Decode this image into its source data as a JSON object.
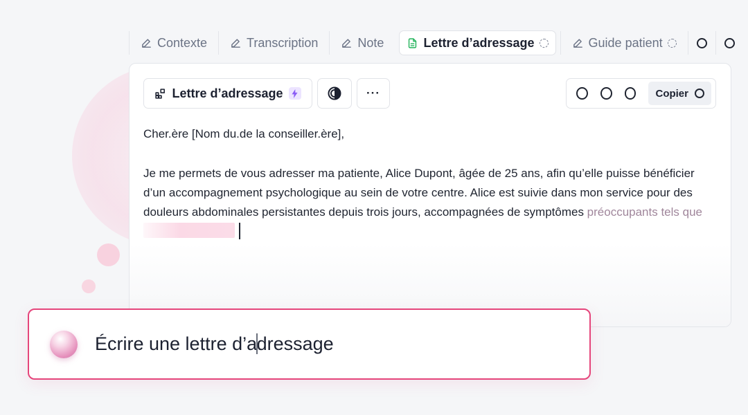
{
  "tabs": [
    {
      "label": "Contexte",
      "icon": "pencil-icon"
    },
    {
      "label": "Transcription",
      "icon": "pencil-icon"
    },
    {
      "label": "Note",
      "icon": "pencil-icon"
    },
    {
      "label": "Lettre d’adressage",
      "icon": "document-icon",
      "active": true,
      "status": "loading"
    },
    {
      "label": "Guide patient",
      "icon": "pencil-icon",
      "status": "loading"
    }
  ],
  "toolbar": {
    "template_label": "Lettre d’adressage",
    "more_label": "···",
    "copy_label": "Copier"
  },
  "letter": {
    "salutation": "Cher.ère [Nom du.de la conseiller.ère],",
    "body": "Je me permets de vous adresser ma patiente, Alice Dupont, âgée de 25 ans, afin qu’elle puisse bénéficier d’un accompagnement psychologique au sein de votre centre. Alice est suivie dans mon service pour des douleurs abdominales persistantes depuis trois jours, accompagnées de symptômes ",
    "streaming": "préoccupants tels que"
  },
  "prompt": {
    "text_before_cursor": "Écrire une lettre d’a",
    "text_after_cursor": "dressage"
  },
  "colors": {
    "accent": "#e5457b",
    "doc_icon": "#22b35a",
    "badge_bolt": "#8b5cf6"
  }
}
